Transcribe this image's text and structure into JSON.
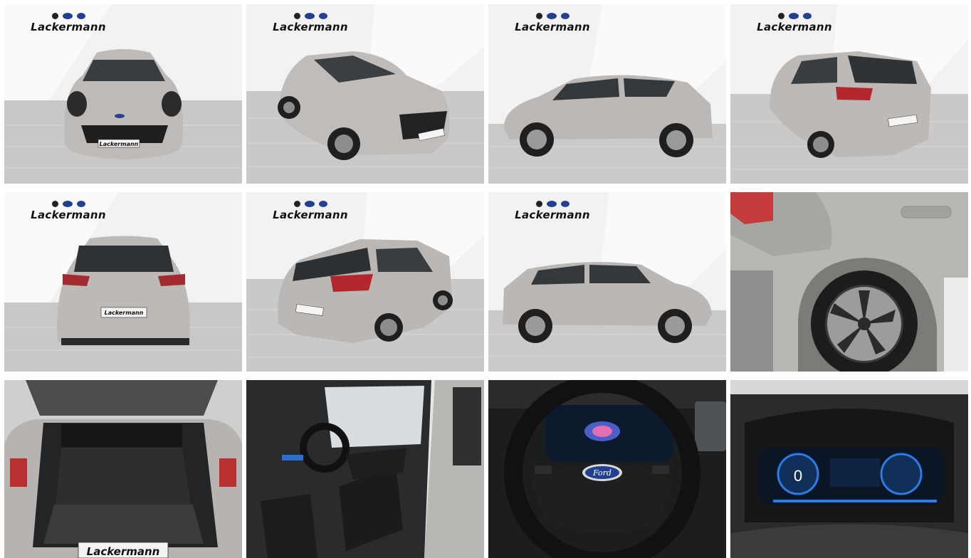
{
  "gallery": {
    "dealer_name": "Lackermann",
    "colors": {
      "car_paint": "#b9b6b2",
      "floor": "#c9c9c9",
      "wall": "#f1f1f1",
      "cluster_blue": "#2d7be6"
    },
    "photos": [
      {
        "view": "front"
      },
      {
        "view": "front-three-quarter"
      },
      {
        "view": "side-left"
      },
      {
        "view": "rear-three-quarter-left"
      },
      {
        "view": "rear"
      },
      {
        "view": "rear-three-quarter-right"
      },
      {
        "view": "side-right"
      },
      {
        "view": "wheel-detail"
      },
      {
        "view": "trunk"
      },
      {
        "view": "front-seats"
      },
      {
        "view": "steering-wheel"
      },
      {
        "view": "instrument-cluster"
      }
    ],
    "cluster": {
      "speed": "0"
    }
  }
}
